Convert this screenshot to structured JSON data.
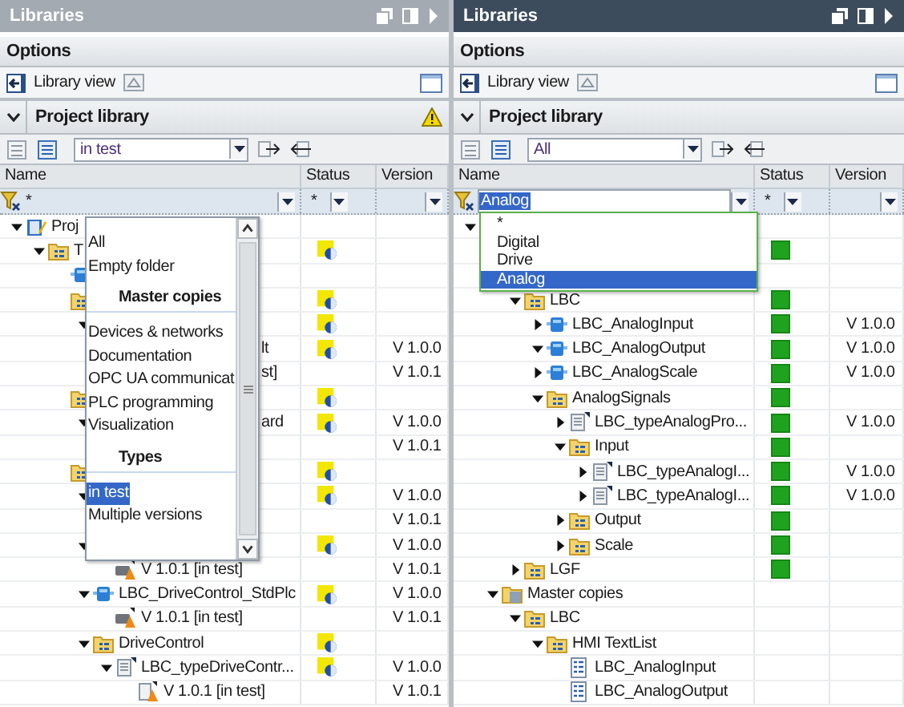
{
  "panels": [
    {
      "title": "Libraries",
      "active": false,
      "options_label": "Options",
      "library_view": "Library view",
      "project_library": {
        "title": "Project library",
        "warning": true
      },
      "toolbar": {
        "filter_value": "in test"
      },
      "columns": [
        "Name",
        "Status",
        "Version"
      ],
      "filter_row": {
        "name_value": "*",
        "name_highlighted": false,
        "status_value": "*"
      },
      "dropdown": {
        "kind": "toolbar-list",
        "items": [
          {
            "kind": "item",
            "label": "All",
            "selected": false
          },
          {
            "kind": "item",
            "label": "Empty folder",
            "selected": false
          },
          {
            "kind": "header",
            "label": "Master copies"
          },
          {
            "kind": "item",
            "label": "Devices & networks",
            "selected": false
          },
          {
            "kind": "item",
            "label": "Documentation",
            "selected": false
          },
          {
            "kind": "item",
            "label": "OPC UA communicat",
            "selected": false
          },
          {
            "kind": "item",
            "label": "PLC programming",
            "selected": false
          },
          {
            "kind": "item",
            "label": "Visualization",
            "selected": false
          },
          {
            "kind": "header",
            "label": "Types"
          },
          {
            "kind": "item",
            "label": "in test",
            "selected": true
          },
          {
            "kind": "item",
            "label": "Multiple versions",
            "selected": false
          }
        ]
      },
      "tree": [
        {
          "label": "Proj",
          "kind": "project",
          "expanded": true,
          "children": [
            {
              "label": "T",
              "kind": "folder",
              "expanded": true,
              "status": {
                "kind": "in-test"
              },
              "children": [
                {
                  "kind": "block"
                },
                {
                  "kind": "folder",
                  "status": {
                    "kind": "in-test"
                  },
                  "children": [
                    {
                      "expanded": true,
                      "status": {
                        "kind": "in-test"
                      },
                      "children": [
                        {
                          "tail": "lt",
                          "status": {
                            "kind": "in-test"
                          },
                          "version": "V 1.0.0",
                          "children": [
                            {
                              "tail": "st]",
                              "version": "V 1.0.1"
                            }
                          ]
                        }
                      ]
                    }
                  ]
                },
                {
                  "kind": "folder",
                  "status": {
                    "kind": "in-test"
                  },
                  "children": [
                    {
                      "tail": "ard",
                      "expanded": true,
                      "status": {
                        "kind": "in-test"
                      },
                      "version": "V 1.0.0",
                      "children": [
                        {
                          "version": "V 1.0.1"
                        }
                      ]
                    }
                  ]
                },
                {
                  "kind": "folder",
                  "status": {
                    "kind": "in-test"
                  },
                  "children": [
                    {
                      "expanded": true,
                      "status": {
                        "kind": "in-test"
                      },
                      "version": "V 1.0.0",
                      "children": [
                        {
                          "version": "V 1.0.1"
                        }
                      ]
                    },
                    {
                      "expanded": true,
                      "status": {
                        "kind": "in-test"
                      },
                      "version": "V 1.0.0",
                      "children": [
                        {
                          "label": "V 1.0.1 [in test]",
                          "kind": "version-block",
                          "version": "V 1.0.1"
                        }
                      ]
                    },
                    {
                      "label": "LBC_DriveControl_StdPlc",
                      "kind": "block",
                      "expanded": true,
                      "status": {
                        "kind": "in-test"
                      },
                      "version": "V 1.0.0",
                      "children": [
                        {
                          "label": "V 1.0.1 [in test]",
                          "kind": "version-block",
                          "version": "V 1.0.1"
                        }
                      ]
                    },
                    {
                      "label": "DriveControl",
                      "kind": "folder",
                      "expanded": true,
                      "status": {
                        "kind": "in-test"
                      },
                      "children": [
                        {
                          "label": "LBC_typeDriveContr...",
                          "kind": "type",
                          "expanded": true,
                          "status": {
                            "kind": "in-test"
                          },
                          "version": "V 1.0.0",
                          "children": [
                            {
                              "label": "V 1.0.1 [in test]",
                              "kind": "version-type",
                              "version": "V 1.0.1"
                            }
                          ]
                        }
                      ]
                    }
                  ]
                }
              ]
            }
          ]
        }
      ]
    },
    {
      "title": "Libraries",
      "active": true,
      "options_label": "Options",
      "library_view": "Library view",
      "project_library": {
        "title": "Project library",
        "warning": false
      },
      "toolbar": {
        "filter_value": "All"
      },
      "columns": [
        "Name",
        "Status",
        "Version"
      ],
      "filter_row": {
        "name_value": "Analog",
        "name_highlighted": true,
        "status_value": "*"
      },
      "dropdown": {
        "kind": "filter-list",
        "items": [
          {
            "kind": "item",
            "label": "*",
            "selected": false
          },
          {
            "kind": "item",
            "label": "Digital",
            "selected": false
          },
          {
            "kind": "item",
            "label": "Drive",
            "selected": false
          },
          {
            "kind": "item",
            "label": "Analog",
            "selected": true
          }
        ]
      },
      "tree": [
        {
          "expanded": true,
          "children": [
            {
              "status": {
                "kind": "ok"
              },
              "children": [
                {
                  "kind": "folder"
                },
                {
                  "label": "LBC",
                  "kind": "folder",
                  "expanded": true,
                  "status": {
                    "kind": "ok"
                  },
                  "children": [
                    {
                      "label": "LBC_AnalogInput",
                      "kind": "block",
                      "expanded": false,
                      "status": {
                        "kind": "ok"
                      },
                      "version": "V 1.0.0"
                    },
                    {
                      "label": "LBC_AnalogOutput",
                      "kind": "block",
                      "expanded": true,
                      "status": {
                        "kind": "ok"
                      },
                      "version": "V 1.0.0"
                    },
                    {
                      "label": "LBC_AnalogScale",
                      "kind": "block",
                      "expanded": false,
                      "status": {
                        "kind": "ok"
                      },
                      "version": "V 1.0.0"
                    },
                    {
                      "label": "AnalogSignals",
                      "kind": "folder",
                      "expanded": true,
                      "status": {
                        "kind": "ok"
                      },
                      "children": [
                        {
                          "label": "LBC_typeAnalogPro...",
                          "kind": "type",
                          "expanded": false,
                          "status": {
                            "kind": "ok"
                          },
                          "version": "V 1.0.0"
                        },
                        {
                          "label": "Input",
                          "kind": "folder",
                          "expanded": true,
                          "status": {
                            "kind": "ok"
                          },
                          "children": [
                            {
                              "label": "LBC_typeAnalogI...",
                              "kind": "type",
                              "expanded": false,
                              "status": {
                                "kind": "ok"
                              },
                              "version": "V 1.0.0"
                            },
                            {
                              "label": "LBC_typeAnalogI...",
                              "kind": "type",
                              "expanded": false,
                              "status": {
                                "kind": "ok"
                              },
                              "version": "V 1.0.0"
                            }
                          ]
                        },
                        {
                          "label": "Output",
                          "kind": "folder",
                          "expanded": false,
                          "status": {
                            "kind": "ok"
                          }
                        },
                        {
                          "label": "Scale",
                          "kind": "folder",
                          "expanded": false,
                          "status": {
                            "kind": "ok"
                          }
                        }
                      ]
                    }
                  ]
                },
                {
                  "label": "LGF",
                  "kind": "folder",
                  "expanded": false,
                  "status": {
                    "kind": "ok"
                  }
                }
              ]
            },
            {
              "label": "Master copies",
              "kind": "master-folder",
              "expanded": true,
              "children": [
                {
                  "label": "LBC",
                  "kind": "folder",
                  "expanded": true,
                  "children": [
                    {
                      "label": "HMI TextList",
                      "kind": "folder",
                      "expanded": true,
                      "children": [
                        {
                          "label": "LBC_AnalogInput",
                          "kind": "textlist"
                        },
                        {
                          "label": "LBC_AnalogOutput",
                          "kind": "textlist"
                        }
                      ]
                    }
                  ]
                }
              ]
            }
          ]
        }
      ]
    }
  ]
}
